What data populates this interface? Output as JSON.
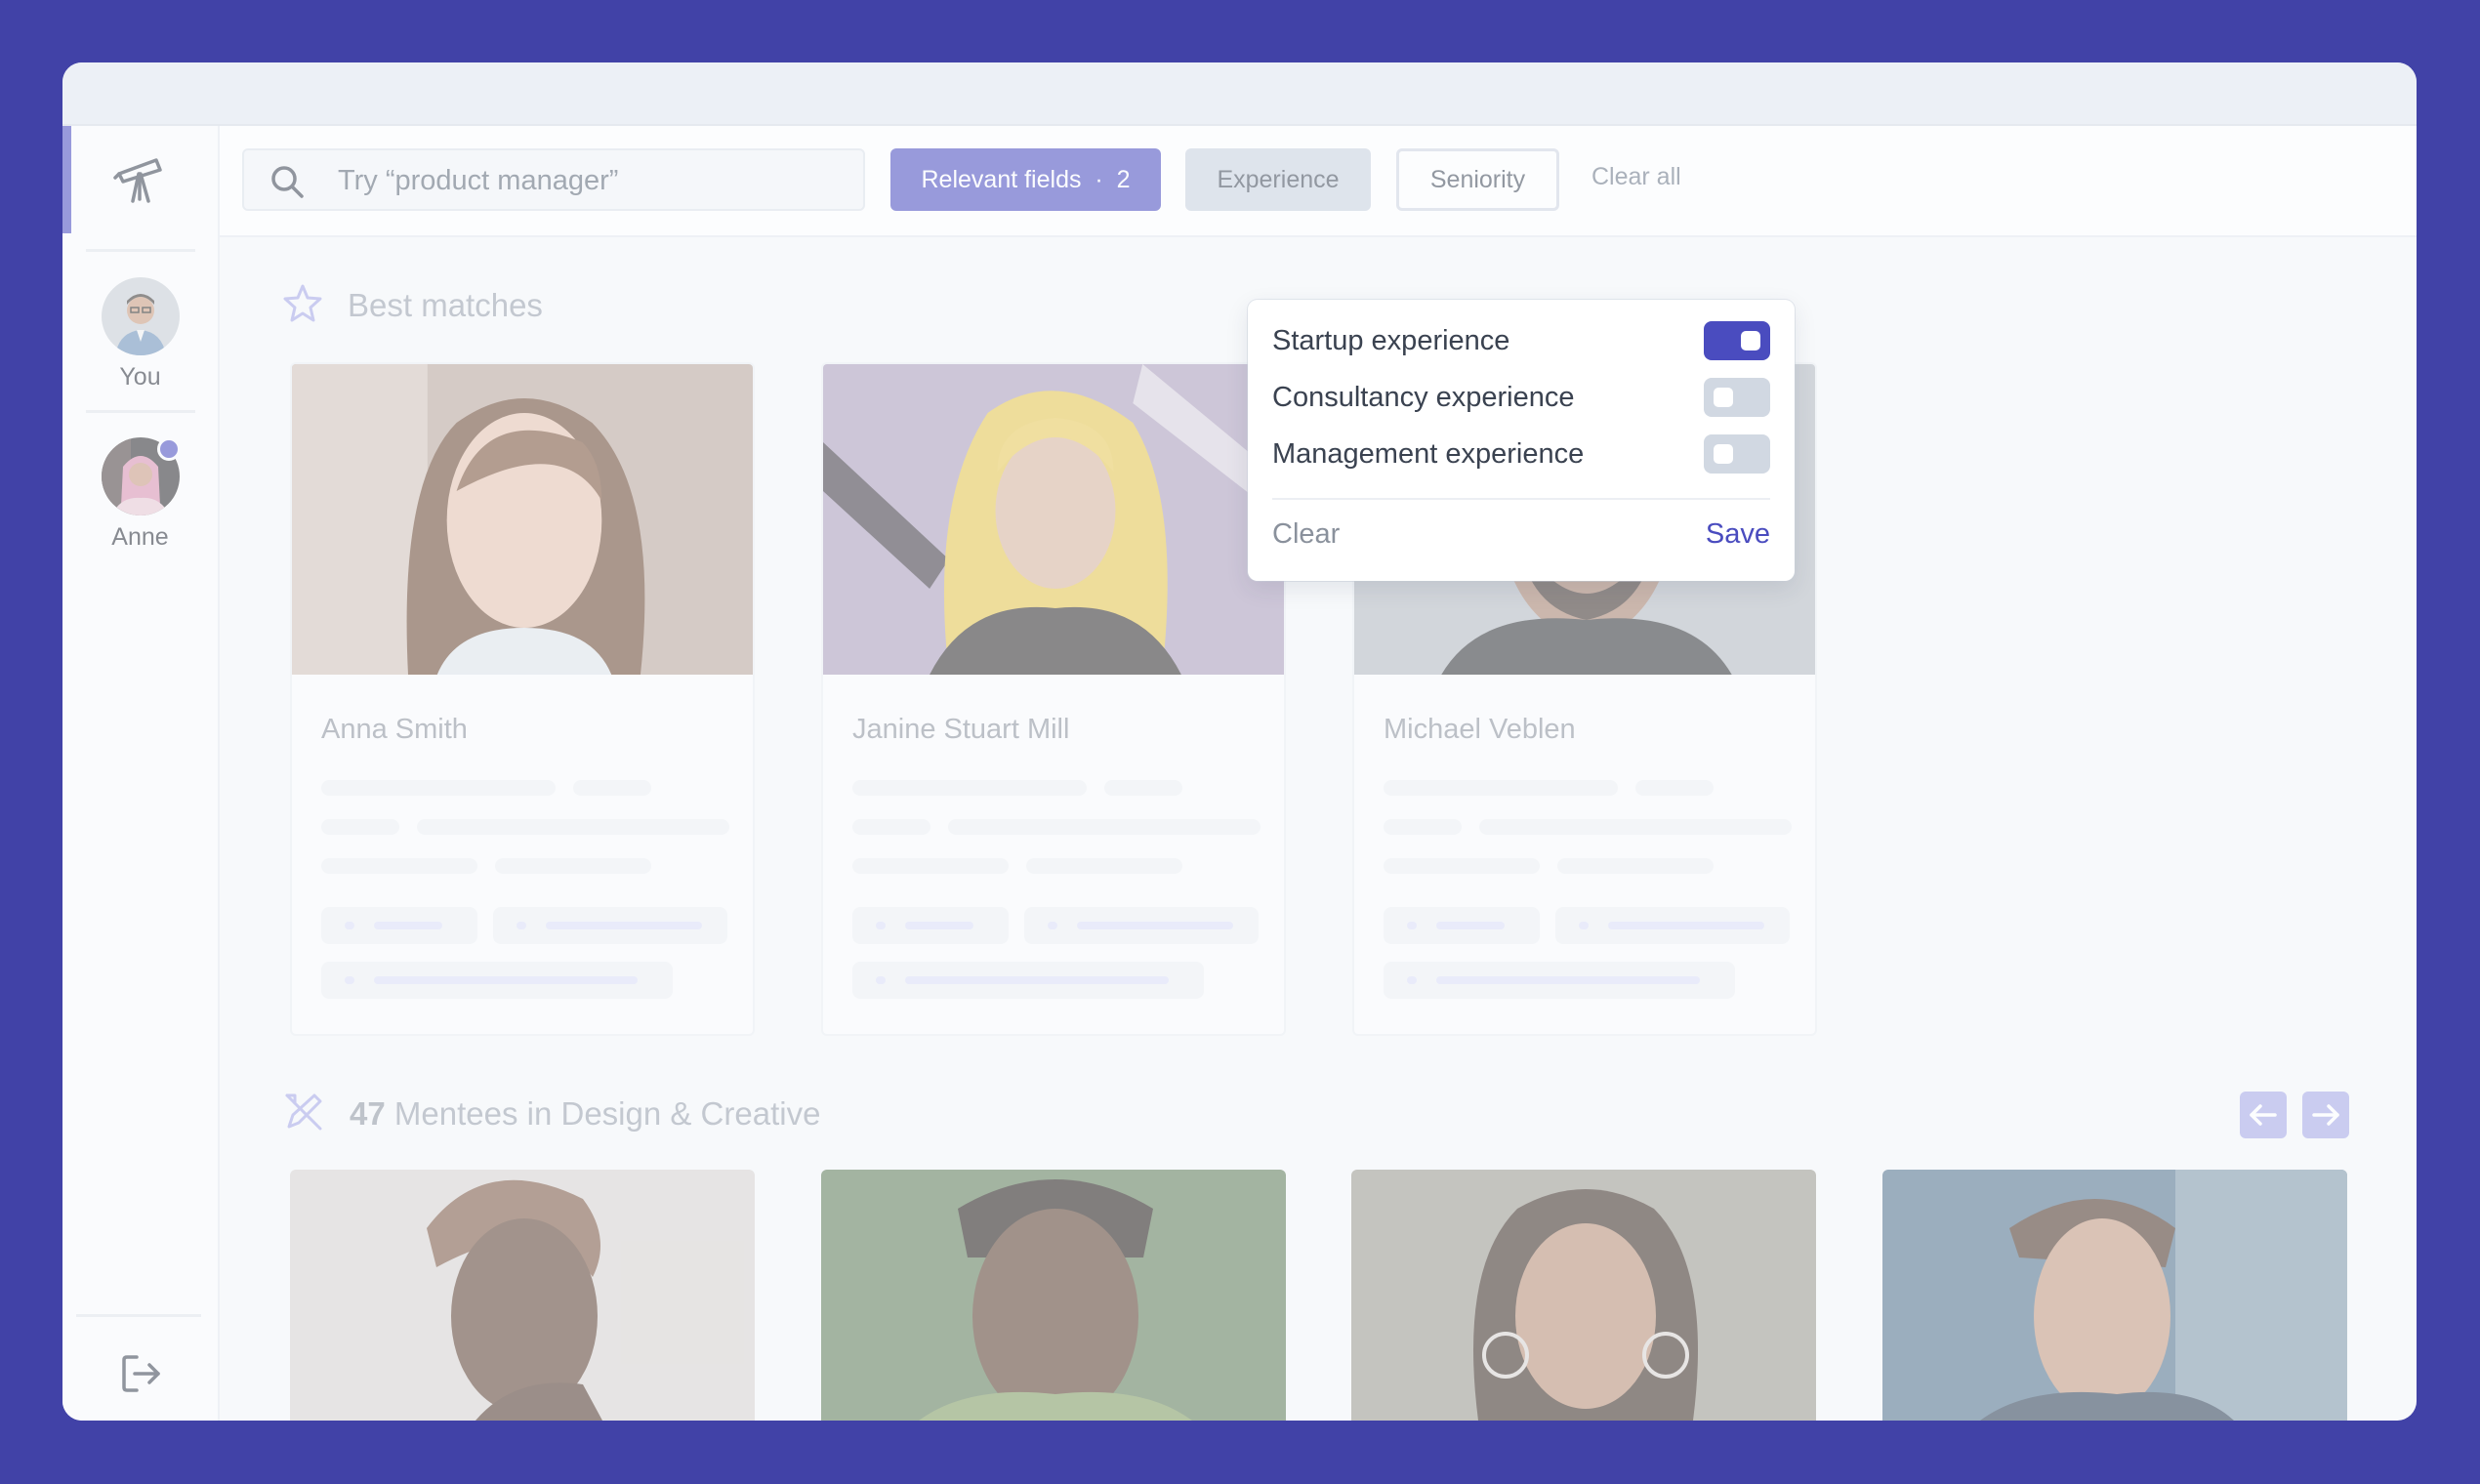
{
  "search": {
    "placeholder": "Try “product manager”"
  },
  "filters": {
    "relevant_fields": "Relevant fields  ·  2",
    "experience": "Experience",
    "seniority": "Seniority",
    "clear_all": "Clear all"
  },
  "sidebar": {
    "users": [
      {
        "name": "You"
      },
      {
        "name": "Anne"
      }
    ]
  },
  "best_matches": {
    "title": "Best matches",
    "cards": [
      {
        "name": "Anna Smith"
      },
      {
        "name": "Janine Stuart Mill"
      },
      {
        "name": "Michael Veblen"
      }
    ]
  },
  "mentees": {
    "count": "47",
    "title": "Mentees in Design & Creative"
  },
  "experience_popover": {
    "options": [
      {
        "label": "Startup experience",
        "enabled": true
      },
      {
        "label": "Consultancy experience",
        "enabled": false
      },
      {
        "label": "Management experience",
        "enabled": false
      }
    ],
    "clear": "Clear",
    "save": "Save"
  },
  "colors": {
    "accent": "#4a4cbf",
    "background": "#4142a7"
  }
}
